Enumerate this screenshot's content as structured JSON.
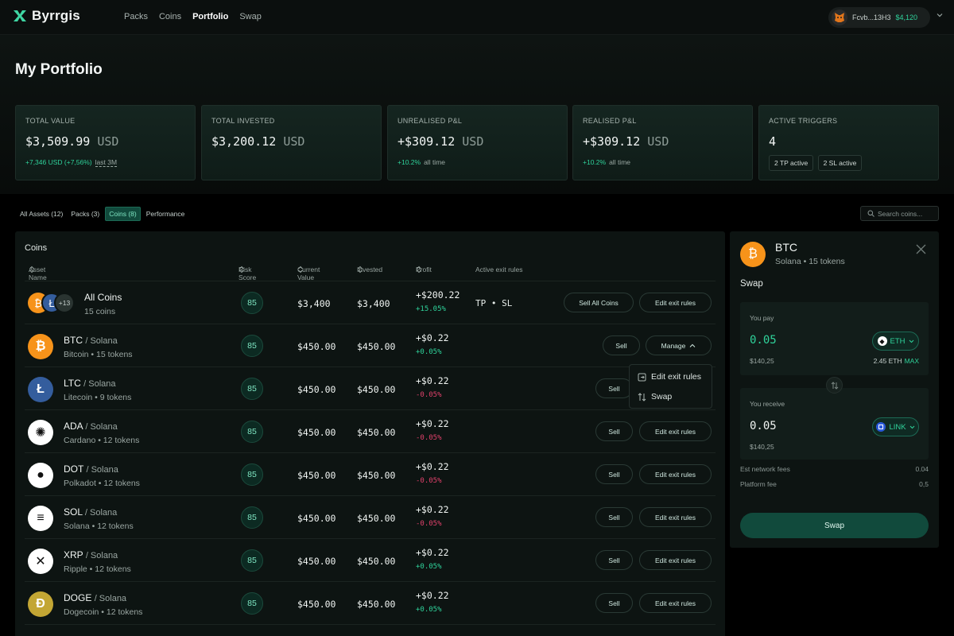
{
  "app": {
    "brand": "Byrrgis",
    "nav": [
      "Packs",
      "Coins",
      "Portfolio",
      "Swap"
    ],
    "active_nav": "Portfolio",
    "wallet": {
      "address": "Fcvb...13H3",
      "balance": "$4,120"
    }
  },
  "page": {
    "title": "My Portfolio"
  },
  "stats": {
    "total_value": {
      "label": "TOTAL VALUE",
      "value": "$3,509.99",
      "currency": "USD",
      "change": "+7,346 USD (+7,56%)",
      "period": "last 3M"
    },
    "total_invested": {
      "label": "TOTAL INVESTED",
      "value": "$3,200.12",
      "currency": "USD"
    },
    "unrealised": {
      "label": "UNREALISED P&L",
      "value": "+$309.12",
      "currency": "USD",
      "change": "+10.2%",
      "period": "all time"
    },
    "realised": {
      "label": "REALISED P&L",
      "value": "+$309.12",
      "currency": "USD",
      "change": "+10.2%",
      "period": "all time"
    },
    "triggers": {
      "label": "ACTIVE TRIGGERS",
      "value": "4",
      "tp": "2 TP active",
      "sl": "2 SL active"
    }
  },
  "tabs": [
    "All Assets (12)",
    "Packs (3)",
    "Coins (8)",
    "Performance"
  ],
  "active_tab": "Coins (8)",
  "search": {
    "placeholder": "Search coins..."
  },
  "table": {
    "title": "Coins",
    "headers": {
      "asset": "Asset Name",
      "risk": "Risk Score",
      "current": "Current Value",
      "invested": "Invested",
      "profit": "Profit",
      "rules": "Active exit rules"
    },
    "all_row": {
      "name": "All Coins",
      "sub": "15 coins",
      "more": "+13",
      "risk": "85",
      "current": "$3,400",
      "invested": "$3,400",
      "profit": "+$200.22",
      "pct": "+15.05%",
      "rules": "TP • SL",
      "sell_label": "Sell All Coins",
      "edit_label": "Edit exit rules"
    },
    "rows": [
      {
        "symbol": "BTC",
        "chain": "/ Solana",
        "sub": "Bitcoin • 15 tokens",
        "risk": "85",
        "current": "$450.00",
        "invested": "$450.00",
        "profit": "+$0.22",
        "pct": "+0.05%",
        "trend": "pos",
        "sell_label": "Sell",
        "action_label": "Manage",
        "color": "#f7931a",
        "glyph": "₿"
      },
      {
        "symbol": "LTC",
        "chain": "/ Solana",
        "sub": "Litecoin • 9 tokens",
        "risk": "85",
        "current": "$450.00",
        "invested": "$450.00",
        "profit": "+$0.22",
        "pct": "-0.05%",
        "trend": "neg",
        "sell_label": "Sell",
        "action_label": "",
        "color": "#345d9d",
        "glyph": "Ł"
      },
      {
        "symbol": "ADA",
        "chain": "/ Solana",
        "sub": "Cardano • 12 tokens",
        "risk": "85",
        "current": "$450.00",
        "invested": "$450.00",
        "profit": "+$0.22",
        "pct": "-0.05%",
        "trend": "neg",
        "sell_label": "Sell",
        "action_label": "Edit exit rules",
        "color": "#ffffff",
        "glyph": "✺"
      },
      {
        "symbol": "DOT",
        "chain": "/ Solana",
        "sub": "Polkadot • 12 tokens",
        "risk": "85",
        "current": "$450.00",
        "invested": "$450.00",
        "profit": "+$0.22",
        "pct": "-0.05%",
        "trend": "neg",
        "sell_label": "Sell",
        "action_label": "Edit exit rules",
        "color": "#ffffff",
        "glyph": "●"
      },
      {
        "symbol": "SOL",
        "chain": "/ Solana",
        "sub": "Solana • 12 tokens",
        "risk": "85",
        "current": "$450.00",
        "invested": "$450.00",
        "profit": "+$0.22",
        "pct": "-0.05%",
        "trend": "neg",
        "sell_label": "Sell",
        "action_label": "Edit exit rules",
        "color": "#ffffff",
        "glyph": "≡"
      },
      {
        "symbol": "XRP",
        "chain": "/ Solana",
        "sub": "Ripple • 12 tokens",
        "risk": "85",
        "current": "$450.00",
        "invested": "$450.00",
        "profit": "+$0.22",
        "pct": "+0.05%",
        "trend": "pos",
        "sell_label": "Sell",
        "action_label": "Edit exit rules",
        "color": "#ffffff",
        "glyph": "✕"
      },
      {
        "symbol": "DOGE",
        "chain": "/ Solana",
        "sub": "Dogecoin • 12 tokens",
        "risk": "85",
        "current": "$450.00",
        "invested": "$450.00",
        "profit": "+$0.22",
        "pct": "+0.05%",
        "trend": "pos",
        "sell_label": "Sell",
        "action_label": "Edit exit rules",
        "color": "#c3a634",
        "glyph": "Ð"
      }
    ]
  },
  "dropdown": {
    "edit": "Edit exit rules",
    "swap": "Swap"
  },
  "swap_panel": {
    "symbol": "BTC",
    "subtitle": "Solana • 15 tokens",
    "title": "Swap",
    "pay": {
      "label": "You pay",
      "amount": "0.05",
      "usd": "$140,25",
      "token": "ETH",
      "balance": "2.45 ETH",
      "max": "MAX"
    },
    "receive": {
      "label": "You receive",
      "amount": "0.05",
      "usd": "$140,25",
      "token": "LINK"
    },
    "fees": {
      "network_label": "Est network fees",
      "network": "0.04",
      "platform_label": "Platform fee",
      "platform": "0,5"
    },
    "button": "Swap"
  }
}
